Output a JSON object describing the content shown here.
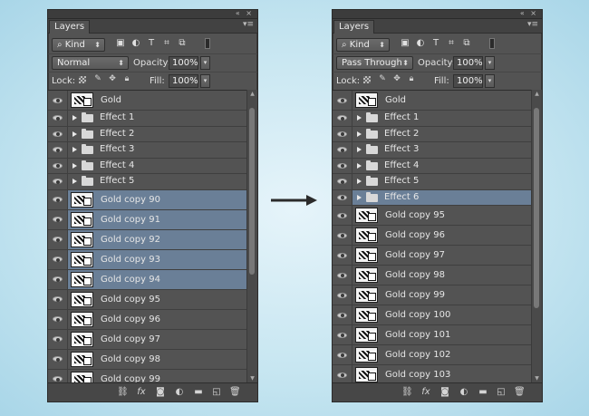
{
  "panels": [
    {
      "tab": "Layers",
      "filter_kind": "Kind",
      "blend_mode": "Normal",
      "opacity_label": "Opacity:",
      "opacity": "100%",
      "lock_label": "Lock:",
      "fill_label": "Fill:",
      "fill": "100%",
      "scroll_thumb_top": 0.04,
      "scroll_thumb_size": 0.6,
      "layers": [
        {
          "type": "image",
          "name": "Gold",
          "selected": false
        },
        {
          "type": "group",
          "name": "Effect 1",
          "selected": false
        },
        {
          "type": "group",
          "name": "Effect 2",
          "selected": false
        },
        {
          "type": "group",
          "name": "Effect 3",
          "selected": false
        },
        {
          "type": "group",
          "name": "Effect 4",
          "selected": false
        },
        {
          "type": "group",
          "name": "Effect 5",
          "selected": false
        },
        {
          "type": "image",
          "name": "Gold copy 90",
          "selected": true
        },
        {
          "type": "image",
          "name": "Gold copy 91",
          "selected": true
        },
        {
          "type": "image",
          "name": "Gold copy 92",
          "selected": true
        },
        {
          "type": "image",
          "name": "Gold copy 93",
          "selected": true
        },
        {
          "type": "image",
          "name": "Gold copy 94",
          "selected": true
        },
        {
          "type": "image",
          "name": "Gold copy 95",
          "selected": false
        },
        {
          "type": "image",
          "name": "Gold copy 96",
          "selected": false
        },
        {
          "type": "image",
          "name": "Gold copy 97",
          "selected": false
        },
        {
          "type": "image",
          "name": "Gold copy 98",
          "selected": false
        },
        {
          "type": "image",
          "name": "Gold copy 99",
          "selected": false
        }
      ]
    },
    {
      "tab": "Layers",
      "filter_kind": "Kind",
      "blend_mode": "Pass Through",
      "opacity_label": "Opacity:",
      "opacity": "100%",
      "lock_label": "Lock:",
      "fill_label": "Fill:",
      "fill": "100%",
      "scroll_thumb_top": 0.04,
      "scroll_thumb_size": 0.72,
      "layers": [
        {
          "type": "image",
          "name": "Gold",
          "selected": false
        },
        {
          "type": "group",
          "name": "Effect 1",
          "selected": false
        },
        {
          "type": "group",
          "name": "Effect 2",
          "selected": false
        },
        {
          "type": "group",
          "name": "Effect 3",
          "selected": false
        },
        {
          "type": "group",
          "name": "Effect 4",
          "selected": false
        },
        {
          "type": "group",
          "name": "Effect 5",
          "selected": false
        },
        {
          "type": "group",
          "name": "Effect 6",
          "selected": true
        },
        {
          "type": "image",
          "name": "Gold copy 95",
          "selected": false
        },
        {
          "type": "image",
          "name": "Gold copy 96",
          "selected": false
        },
        {
          "type": "image",
          "name": "Gold copy 97",
          "selected": false
        },
        {
          "type": "image",
          "name": "Gold copy 98",
          "selected": false
        },
        {
          "type": "image",
          "name": "Gold copy 99",
          "selected": false
        },
        {
          "type": "image",
          "name": "Gold copy 100",
          "selected": false
        },
        {
          "type": "image",
          "name": "Gold copy 101",
          "selected": false
        },
        {
          "type": "image",
          "name": "Gold copy 102",
          "selected": false
        },
        {
          "type": "image",
          "name": "Gold copy 103",
          "selected": false
        }
      ]
    }
  ],
  "icons": {
    "filter": "search-icon",
    "lock_transparent": "checker-icon",
    "lock_brush": "brush-icon",
    "lock_move": "move-icon",
    "lock_all": "lock-icon",
    "bottom": [
      "link-icon",
      "fx-icon",
      "mask-icon",
      "adjustment-icon",
      "folder-icon",
      "new-layer-icon",
      "trash-icon"
    ]
  },
  "colors": {
    "selected_row": "#6a7f97",
    "panel_bg": "#535353"
  }
}
